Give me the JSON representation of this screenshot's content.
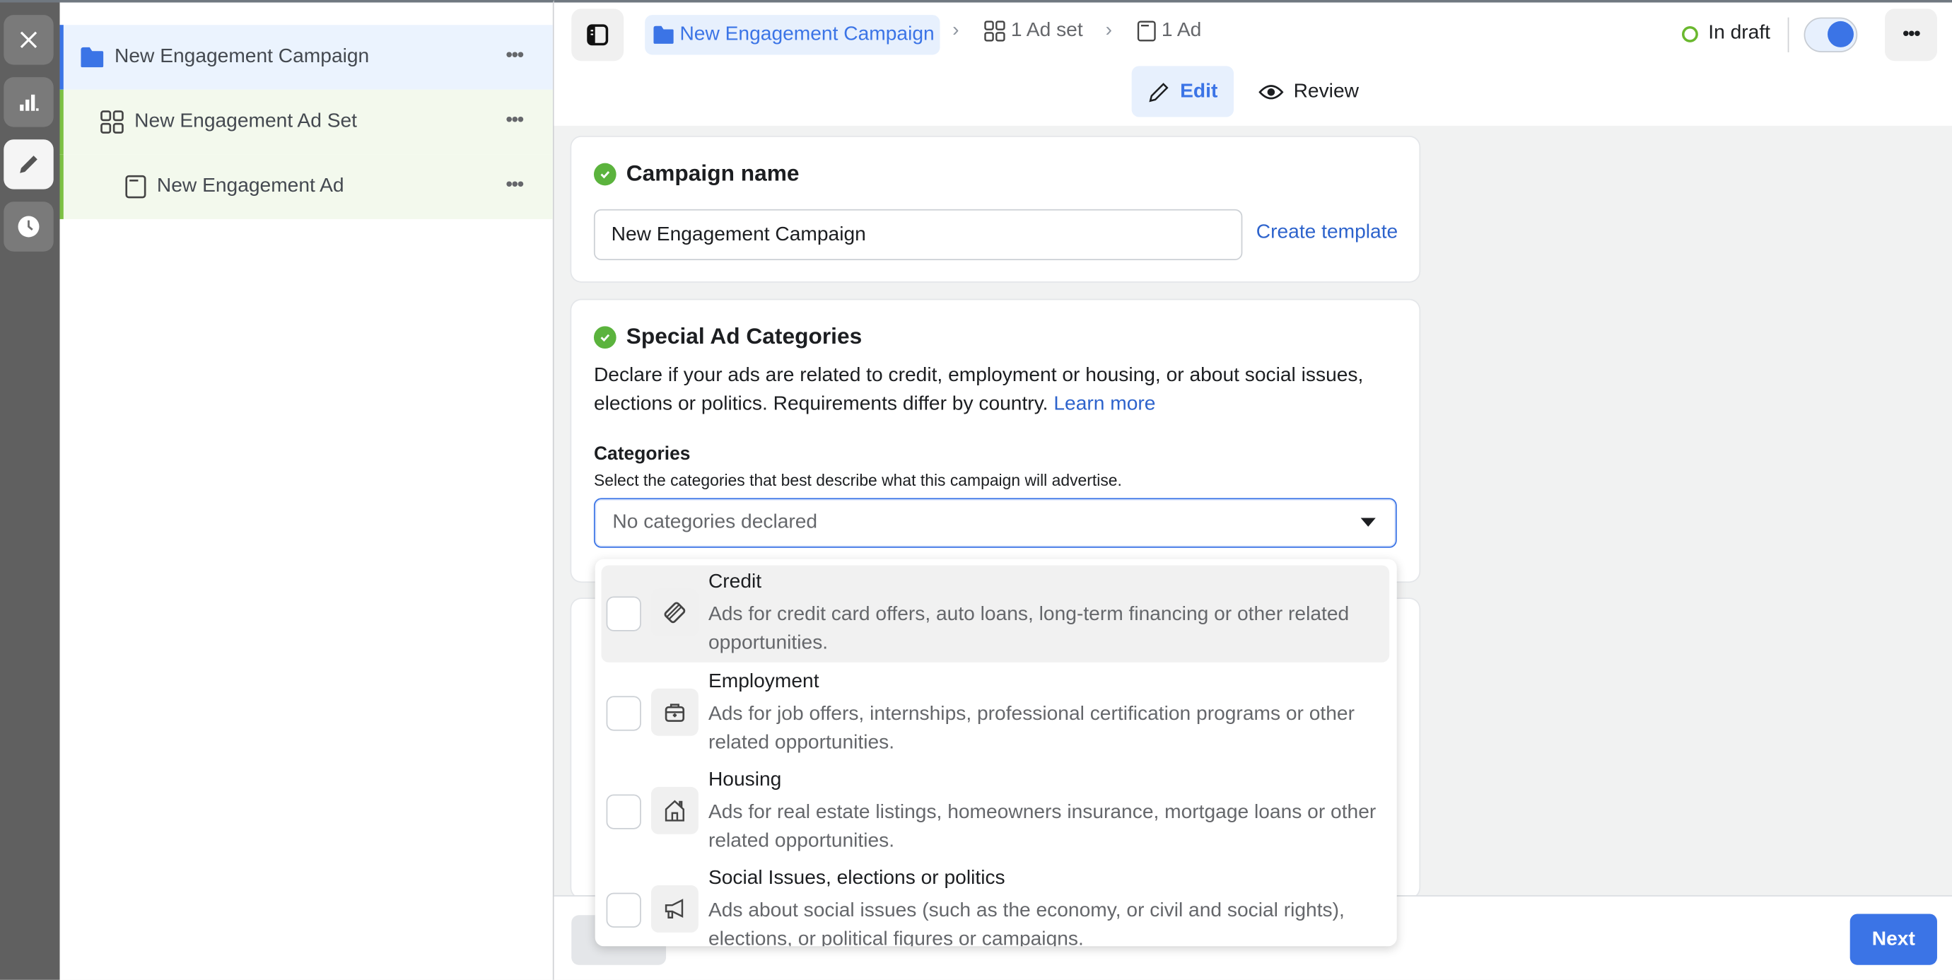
{
  "rail": {
    "items": [
      {
        "icon": "close-icon"
      },
      {
        "icon": "bar-chart-icon"
      },
      {
        "icon": "pencil-icon",
        "active": true
      },
      {
        "icon": "clock-icon"
      }
    ]
  },
  "tree": {
    "campaign": {
      "label": "New Engagement Campaign",
      "more": "•••"
    },
    "adset": {
      "label": "New Engagement Ad Set",
      "more": "•••"
    },
    "ad": {
      "label": "New Engagement Ad",
      "more": "•••"
    }
  },
  "header": {
    "breadcrumb": {
      "campaign": "New Engagement Campaign",
      "sep": "›",
      "adset": "1 Ad set",
      "ad": "1 Ad"
    },
    "status": "In draft",
    "toggle_on": true,
    "more": "•••",
    "modes": {
      "edit": "Edit",
      "review": "Review"
    }
  },
  "campaign_name": {
    "title": "Campaign name",
    "value": "New Engagement Campaign",
    "create_template": "Create template"
  },
  "special_ad": {
    "title": "Special Ad Categories",
    "description": "Declare if your ads are related to credit, employment or housing, or about social issues, elections or politics. Requirements differ by country.",
    "learn_more": "Learn more",
    "categories_label": "Categories",
    "categories_help": "Select the categories that best describe what this campaign will advertise.",
    "select_value": "No categories declared",
    "options": [
      {
        "title": "Credit",
        "desc": "Ads for credit card offers, auto loans, long-term financing or other related opportunities.",
        "icon": "credit-card-icon",
        "checked": false
      },
      {
        "title": "Employment",
        "desc": "Ads for job offers, internships, professional certification programs or other related opportunities.",
        "icon": "briefcase-icon",
        "checked": false
      },
      {
        "title": "Housing",
        "desc": "Ads for real estate listings, homeowners insurance, mortgage loans or other related opportunities.",
        "icon": "house-icon",
        "checked": false
      },
      {
        "title": "Social Issues, elections or politics",
        "desc": "Ads about social issues (such as the economy, or civil and social rights), elections, or political figures or campaigns.",
        "icon": "megaphone-icon",
        "checked": false
      }
    ]
  },
  "footer": {
    "next": "Next"
  },
  "colors": {
    "accent": "#3b74e6",
    "success": "#5bb33d",
    "draft": "#6ab82e"
  }
}
